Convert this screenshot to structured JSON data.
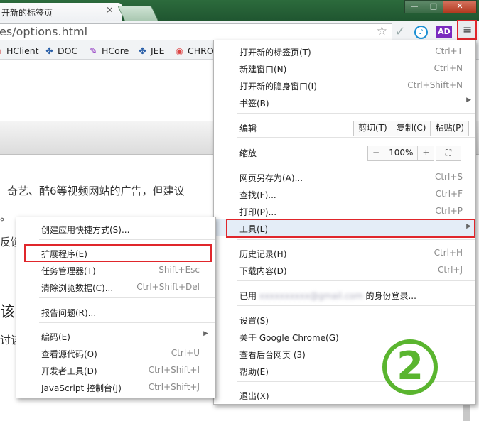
{
  "window": {
    "tab_title": "开新的标签页",
    "tab_close": "×",
    "min": "—",
    "max": "□",
    "close": "✕"
  },
  "toolbar": {
    "url": "es/options.html",
    "star": "☆",
    "check": "✓",
    "music": "♪",
    "ad": "AD",
    "menu_icon": "≡"
  },
  "bookmarks": [
    {
      "label": "HClient",
      "icon": "hclient-icon"
    },
    {
      "label": "DOC",
      "icon": "doc-icon"
    },
    {
      "label": "HCore",
      "icon": "hcore-icon"
    },
    {
      "label": "JEE",
      "icon": "jee-icon"
    },
    {
      "label": "CHRO",
      "icon": "chrome-icon"
    }
  ],
  "page": {
    "line1": "奇艺、酷6等视频网站的广告，但建议",
    "line2": "。",
    "line3": "反馈",
    "heading": "该",
    "line5": "讨该"
  },
  "main_menu": {
    "new_tab": {
      "label": "打开新的标签页(T)",
      "shortcut": "Ctrl+T"
    },
    "new_window": {
      "label": "新建窗口(N)",
      "shortcut": "Ctrl+N"
    },
    "incognito": {
      "label": "打开新的隐身窗口(I)",
      "shortcut": "Ctrl+Shift+N"
    },
    "bookmarks": {
      "label": "书签(B)"
    },
    "edit": {
      "label": "编辑",
      "cut": "剪切(T)",
      "copy": "复制(C)",
      "paste": "粘贴(P)"
    },
    "zoom": {
      "label": "缩放",
      "minus": "−",
      "level": "100%",
      "plus": "+",
      "fullscreen": "⛶"
    },
    "save_as": {
      "label": "网页另存为(A)...",
      "shortcut": "Ctrl+S"
    },
    "find": {
      "label": "查找(F)...",
      "shortcut": "Ctrl+F"
    },
    "print": {
      "label": "打印(P)...",
      "shortcut": "Ctrl+P"
    },
    "tools": {
      "label": "工具(L)"
    },
    "history": {
      "label": "历史记录(H)",
      "shortcut": "Ctrl+H"
    },
    "downloads": {
      "label": "下载内容(D)",
      "shortcut": "Ctrl+J"
    },
    "signed_in": {
      "prefix": "已用",
      "email": "xxxxxxxxxx@gmail.com",
      "suffix": "的身份登录..."
    },
    "settings": {
      "label": "设置(S)"
    },
    "about": {
      "label": "关于 Google Chrome(G)"
    },
    "background": {
      "label": "查看后台网页 (3)"
    },
    "help": {
      "label": "帮助(E)"
    },
    "exit": {
      "label": "退出(X)"
    }
  },
  "tools_submenu": {
    "create_shortcut": {
      "label": "创建应用快捷方式(S)..."
    },
    "extensions": {
      "label": "扩展程序(E)"
    },
    "task_manager": {
      "label": "任务管理器(T)",
      "shortcut": "Shift+Esc"
    },
    "clear_data": {
      "label": "清除浏览数据(C)...",
      "shortcut": "Ctrl+Shift+Del"
    },
    "report_issue": {
      "label": "报告问题(R)..."
    },
    "encoding": {
      "label": "编码(E)"
    },
    "view_source": {
      "label": "查看源代码(O)",
      "shortcut": "Ctrl+U"
    },
    "dev_tools": {
      "label": "开发者工具(D)",
      "shortcut": "Ctrl+Shift+I"
    },
    "js_console": {
      "label": "JavaScript 控制台(J)",
      "shortcut": "Ctrl+Shift+J"
    }
  },
  "arrow": "▶",
  "step_marker": "2",
  "colors": {
    "highlight_border": "#e0262b",
    "step_green": "#5ab52f",
    "titlebar": "#2c6b3c"
  }
}
